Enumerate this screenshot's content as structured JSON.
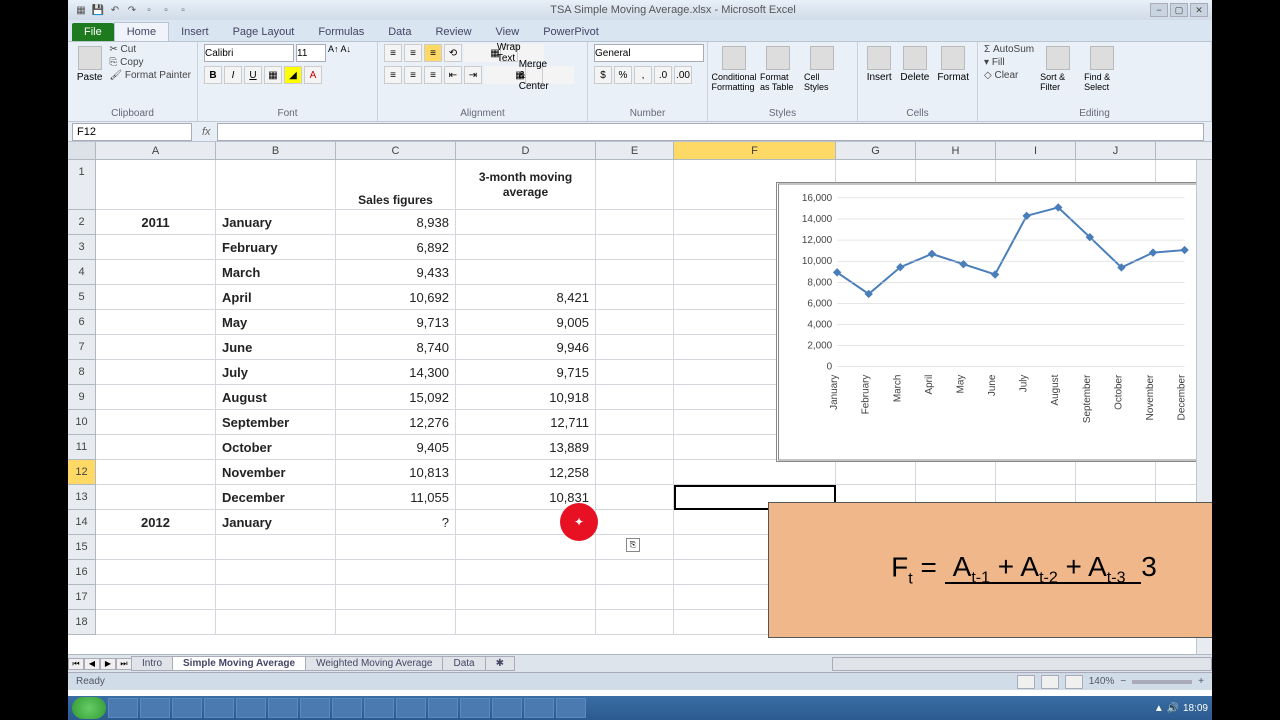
{
  "app": {
    "title": "TSA Simple Moving Average.xlsx - Microsoft Excel",
    "namebox": "F12",
    "formula": ""
  },
  "tabs": {
    "file": "File",
    "home": "Home",
    "insert": "Insert",
    "pagelayout": "Page Layout",
    "formulas": "Formulas",
    "data": "Data",
    "review": "Review",
    "view": "View",
    "powerpivot": "PowerPivot"
  },
  "ribbon": {
    "clipboard": {
      "label": "Clipboard",
      "paste": "Paste",
      "cut": "Cut",
      "copy": "Copy",
      "fmtpainter": "Format Painter"
    },
    "font": {
      "label": "Font",
      "name": "Calibri",
      "size": "11"
    },
    "alignment": {
      "label": "Alignment",
      "wrap": "Wrap Text",
      "merge": "Merge & Center"
    },
    "number": {
      "label": "Number",
      "format": "General"
    },
    "styles": {
      "label": "Styles",
      "cond": "Conditional Formatting",
      "fmt": "Format as Table",
      "cell": "Cell Styles"
    },
    "cells": {
      "label": "Cells",
      "insert": "Insert",
      "delete": "Delete",
      "format": "Format"
    },
    "editing": {
      "label": "Editing",
      "autosum": "AutoSum",
      "fill": "Fill",
      "clear": "Clear",
      "sort": "Sort & Filter",
      "find": "Find & Select"
    }
  },
  "columns": [
    "A",
    "B",
    "C",
    "D",
    "E",
    "F",
    "G",
    "H",
    "I",
    "J"
  ],
  "rows": [
    "1",
    "2",
    "3",
    "4",
    "5",
    "6",
    "7",
    "8",
    "9",
    "10",
    "11",
    "12",
    "13",
    "14",
    "15",
    "16",
    "17",
    "18"
  ],
  "sheet": {
    "headers": {
      "C1": "Sales figures",
      "D1": "3-month moving average"
    },
    "data": [
      {
        "r": 2,
        "A": "2011",
        "B": "January",
        "C": "8,938",
        "D": ""
      },
      {
        "r": 3,
        "A": "",
        "B": "February",
        "C": "6,892",
        "D": ""
      },
      {
        "r": 4,
        "A": "",
        "B": "March",
        "C": "9,433",
        "D": ""
      },
      {
        "r": 5,
        "A": "",
        "B": "April",
        "C": "10,692",
        "D": "8,421"
      },
      {
        "r": 6,
        "A": "",
        "B": "May",
        "C": "9,713",
        "D": "9,005"
      },
      {
        "r": 7,
        "A": "",
        "B": "June",
        "C": "8,740",
        "D": "9,946"
      },
      {
        "r": 8,
        "A": "",
        "B": "July",
        "C": "14,300",
        "D": "9,715"
      },
      {
        "r": 9,
        "A": "",
        "B": "August",
        "C": "15,092",
        "D": "10,918"
      },
      {
        "r": 10,
        "A": "",
        "B": "September",
        "C": "12,276",
        "D": "12,711"
      },
      {
        "r": 11,
        "A": "",
        "B": "October",
        "C": "9,405",
        "D": "13,889"
      },
      {
        "r": 12,
        "A": "",
        "B": "November",
        "C": "10,813",
        "D": "12,258"
      },
      {
        "r": 13,
        "A": "",
        "B": "December",
        "C": "11,055",
        "D": "10,831"
      },
      {
        "r": 14,
        "A": "2012",
        "B": "January",
        "C": "?",
        "D": ""
      }
    ]
  },
  "chart_data": {
    "type": "line",
    "categories": [
      "January",
      "February",
      "March",
      "April",
      "May",
      "June",
      "July",
      "August",
      "September",
      "October",
      "November",
      "December"
    ],
    "values": [
      8938,
      6892,
      9433,
      10692,
      9713,
      8740,
      14300,
      15092,
      12276,
      9405,
      10813,
      11055
    ],
    "ylim": [
      0,
      16000
    ],
    "yticks": [
      0,
      2000,
      4000,
      6000,
      8000,
      10000,
      12000,
      14000,
      16000
    ]
  },
  "formula_overlay": {
    "lhs": "F",
    "lhs_sub": "t",
    "eq": " = ",
    "t1": "A",
    "s1": "t-1",
    "p": " + ",
    "t2": "A",
    "s2": "t-2",
    "t3": "A",
    "s3": "t-3",
    "den": "3"
  },
  "sheettabs": {
    "intro": "Intro",
    "sma": "Simple Moving Average",
    "wma": "Weighted Moving Average",
    "data": "Data"
  },
  "status": {
    "ready": "Ready",
    "zoom": "140%",
    "time": "18:09"
  }
}
